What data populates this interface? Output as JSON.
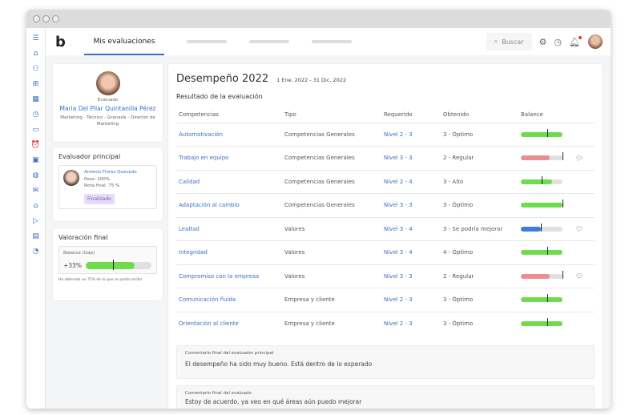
{
  "header": {
    "tab": "Mis evaluaciones",
    "search_placeholder": "Buscar"
  },
  "evaluado": {
    "label": "Evaluado",
    "name": "Maria Del Pilar Quintanilla Pérez",
    "details": "Marketing - Técnico - Granada - Director de Marketing"
  },
  "evaluador": {
    "title": "Evaluador principal",
    "name": "Antonio Flores Quevedo",
    "peso": "Peso: 100%",
    "nota": "Nota final: 75 %",
    "status": "Finalizado"
  },
  "valoracion": {
    "title": "Valoración final",
    "balance_label": "Balance (Gap)",
    "value": "+33%",
    "fill_pct": 75,
    "marker_pct": 42,
    "note": "Ha obtenido un 75% de lo que se podía recibir"
  },
  "main": {
    "title": "Desempeño 2022",
    "dates": "1 Ene, 2022 - 31 Dic, 2022",
    "subtitle": "Resultado de la evaluación",
    "columns": [
      "Competencias",
      "Tipo",
      "Requerido",
      "Obtenido",
      "Balance"
    ],
    "rows": [
      {
        "name": "Automotivación",
        "tipo": "Competencias Generales",
        "req": "Nivel 2 - 3",
        "obt": "3 - Óptimo",
        "fill": 100,
        "marker": 63,
        "color": "#6fdc4e",
        "comment": false
      },
      {
        "name": "Trabajo en equipo",
        "tipo": "Competencias Generales",
        "req": "Nivel 3 - 3",
        "obt": "2 - Regular",
        "fill": 70,
        "marker": 100,
        "color": "#ec8e90",
        "comment": true
      },
      {
        "name": "Calidad",
        "tipo": "Competencias Generales",
        "req": "Nivel 2 - 4",
        "obt": "3 - Alto",
        "fill": 75,
        "marker": 50,
        "color": "#6fdc4e",
        "comment": false
      },
      {
        "name": "Adaptación al cambio",
        "tipo": "Competencias Generales",
        "req": "Nivel 3 - 3",
        "obt": "3 - Óptimo",
        "fill": 100,
        "marker": 100,
        "color": "#6fdc4e",
        "comment": false
      },
      {
        "name": "Lealtad",
        "tipo": "Valores",
        "req": "Nivel 3 - 4",
        "obt": "3 - Se podría mejorar",
        "fill": 48,
        "marker": 48,
        "color": "#3d7ddb",
        "comment": true
      },
      {
        "name": "Integridad",
        "tipo": "Valores",
        "req": "Nivel 3 - 4",
        "obt": "4 - Óptimo",
        "fill": 100,
        "marker": 63,
        "color": "#6fdc4e",
        "comment": false
      },
      {
        "name": "Compromiso con la empresa",
        "tipo": "Valores",
        "req": "Nivel 3 - 3",
        "obt": "2 - Regular",
        "fill": 70,
        "marker": 100,
        "color": "#ec8e90",
        "comment": true
      },
      {
        "name": "Comunicación fluida",
        "tipo": "Empresa y cliente",
        "req": "Nivel 2 - 3",
        "obt": "3 - Óptimo",
        "fill": 100,
        "marker": 63,
        "color": "#6fdc4e",
        "comment": false
      },
      {
        "name": "Orientación al cliente",
        "tipo": "Empresa y cliente",
        "req": "Nivel 2 - 3",
        "obt": "3 - Óptimo",
        "fill": 100,
        "marker": 63,
        "color": "#6fdc4e",
        "comment": false
      }
    ],
    "comments": [
      {
        "title": "Comentario final del evaluador principal",
        "text": "El desempeño ha sido muy bueno. Está dentro de lo esperado"
      },
      {
        "title": "Comentario final del evaluado",
        "text": "Estoy de acuerdo, ya veo en qué áreas aún puedo mejorar"
      }
    ]
  }
}
